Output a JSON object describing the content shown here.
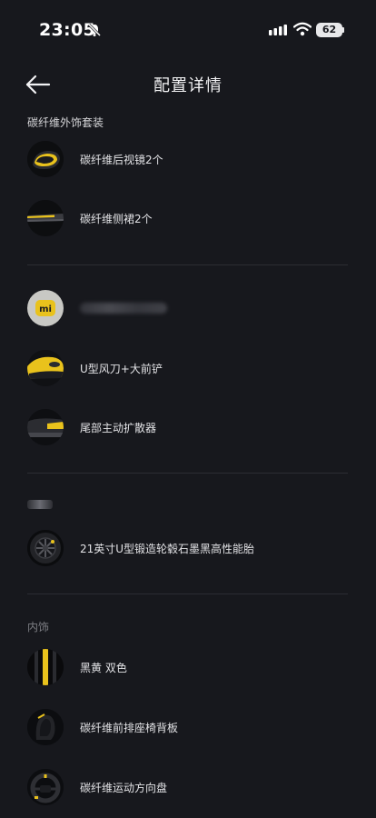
{
  "status": {
    "time": "23:05",
    "battery": "62"
  },
  "header": {
    "title": "配置详情"
  },
  "sections": {
    "exterior_kit": {
      "title": "碳纤维外饰套装",
      "items": [
        {
          "label": "碳纤维后视镜2个",
          "thumb": "mirror-thumbnail"
        },
        {
          "label": "碳纤维侧裙2个",
          "thumb": "side-skirt-thumbnail"
        }
      ]
    },
    "aero": {
      "items": [
        {
          "label": "",
          "thumb": "mi-logo-thumbnail",
          "blurred": true
        },
        {
          "label": "U型风刀+大前铲",
          "thumb": "front-splitter-thumbnail"
        },
        {
          "label": "尾部主动扩散器",
          "thumb": "rear-diffuser-thumbnail"
        }
      ]
    },
    "wheels": {
      "items": [
        {
          "label": "21英寸U型锻造轮毂石墨黑高性能胎",
          "thumb": "wheel-thumbnail"
        }
      ]
    },
    "interior": {
      "title": "内饰",
      "items": [
        {
          "label": "黑黄 双色",
          "thumb": "black-yellow-swatch"
        },
        {
          "label": "碳纤维前排座椅背板",
          "thumb": "seat-back-thumbnail"
        },
        {
          "label": "碳纤维运动方向盘",
          "thumb": "steering-wheel-thumbnail"
        }
      ]
    }
  },
  "colors": {
    "background": "#17181d",
    "accent_yellow": "#e9c21c",
    "text": "#e3e3e6",
    "muted": "#7d7e84"
  }
}
